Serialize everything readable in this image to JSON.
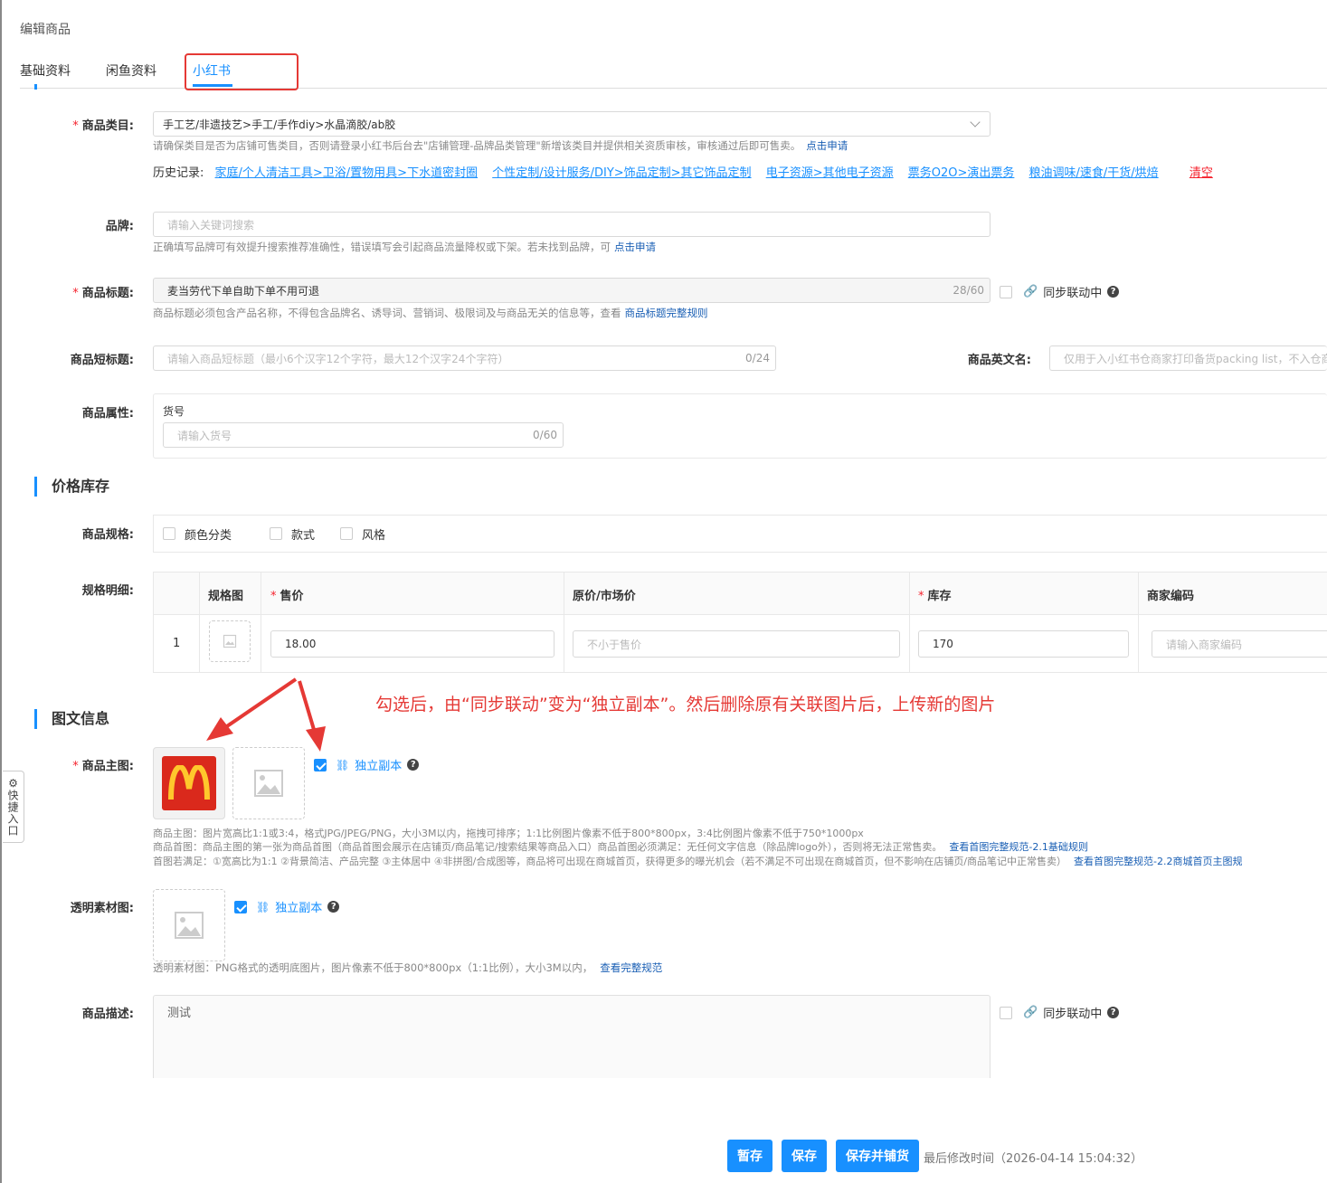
{
  "page_title": "编辑商品",
  "tabs": [
    "基础资料",
    "闲鱼资料",
    "小红书"
  ],
  "category": {
    "label": "商品类目:",
    "value": "手工艺/非遗技艺>手工/手作diy>水晶滴胶/ab胶",
    "hint": "请确保类目是否为店铺可售类目，否则请登录小红书后台去\"店铺管理-品牌品类管理\"新增该类目并提供相关资质审核，审核通过后即可售卖。",
    "hint_link": "点击申请",
    "history_label": "历史记录:",
    "history": [
      "家庭/个人清洁工具>卫浴/置物用具>下水道密封圈",
      "个性定制/设计服务/DIY>饰品定制>其它饰品定制",
      "电子资源>其他电子资源",
      "票务O2O>演出票务",
      "粮油调味/速食/干货/烘焙"
    ],
    "clear": "清空"
  },
  "brand": {
    "label": "品牌:",
    "placeholder": "请输入关键词搜索",
    "hint": "正确填写品牌可有效提升搜索推荐准确性，错误填写会引起商品流量降权或下架。若未找到品牌，可",
    "hint_link": "点击申请"
  },
  "title_field": {
    "label": "商品标题:",
    "value": "麦当劳代下单自助下单不用可退",
    "counter": "28/60",
    "sync": "同步联动中",
    "hint": "商品标题必须包含产品名称，不得包含品牌名、诱导词、营销词、极限词及与商品无关的信息等，查看",
    "hint_link": "商品标题完整规则"
  },
  "short_title": {
    "label": "商品短标题:",
    "placeholder": "请输入商品短标题（最小6个汉字12个字符，最大12个汉字24个字符）",
    "counter": "0/24"
  },
  "english_name": {
    "label": "商品英文名:",
    "placeholder": "仅用于入小红书仓商家打印备货packing list，不入仓商家"
  },
  "attributes": {
    "label": "商品属性:",
    "sub_label": "货号",
    "placeholder": "请输入货号",
    "counter": "0/60"
  },
  "price_section": {
    "title": "价格库存",
    "spec_label": "商品规格:",
    "spec_options": [
      "颜色分类",
      "款式",
      "风格"
    ],
    "detail_label": "规格明细:",
    "columns": [
      "规格图",
      "售价",
      "原价/市场价",
      "库存",
      "商家编码"
    ],
    "row": {
      "index": "1",
      "price": "18.00",
      "orig_placeholder": "不小于售价",
      "stock": "170",
      "code_placeholder": "请输入商家编码"
    }
  },
  "media_section": {
    "title": "图文信息",
    "annotation": "勾选后，由“同步联动”变为“独立副本”。然后删除原有关联图片后，上传新的图片",
    "main_image_label": "商品主图:",
    "independent": "独立副本",
    "hint1": "商品主图：图片宽高比1:1或3:4，格式JPG/JPEG/PNG，大小3M以内，拖拽可排序；1:1比例图片像素不低于800*800px，3:4比例图片像素不低于750*1000px",
    "hint2": "商品首图：商品主图的第一张为商品首图（商品首图会展示在店铺页/商品笔记/搜索结果等商品入口）商品首图必须满足：无任何文字信息（除品牌logo外），否则将无法正常售卖。",
    "hint2_link": "查看首图完整规范-2.1基础规则",
    "hint3": "首图若满足：①宽高比为1:1 ②背景简洁、产品完整 ③主体居中 ④非拼图/合成图等，商品将可出现在商城首页，获得更多的曝光机会（若不满足不可出现在商城首页，但不影响在店铺页/商品笔记中正常售卖）",
    "hint3_link": "查看首图完整规范-2.2商城首页主图规",
    "transparent_label": "透明素材图:",
    "transparent_hint": "透明素材图：PNG格式的透明底图片，图片像素不低于800*800px（1:1比例），大小3M以内，",
    "transparent_link": "查看完整规范",
    "desc_label": "商品描述:",
    "desc_value": "测试",
    "desc_sync": "同步联动中"
  },
  "side_widget": "快捷入口",
  "buttons": [
    "暂存",
    "保存",
    "保存并铺货"
  ],
  "last_modified": "最后修改时间（2026-04-14 15:04:32）",
  "colors": {
    "primary": "#1890ff",
    "danger": "#f5222d",
    "annotation": "#e53935",
    "brand_red": "#da291c",
    "brand_yellow": "#ffc72c"
  }
}
